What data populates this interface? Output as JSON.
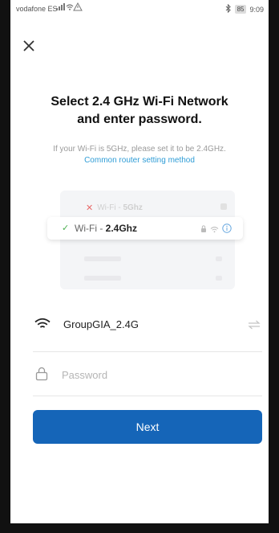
{
  "status_bar": {
    "carrier": "vodafone ES",
    "battery": "85",
    "time": "9:09"
  },
  "header": {
    "close_icon": "close-icon"
  },
  "content": {
    "title_line1": "Select 2.4 GHz Wi-Fi Network",
    "title_line2": "and enter password.",
    "hint": "If your Wi-Fi is 5GHz, please set it to be 2.4GHz.",
    "link": "Common router setting method"
  },
  "illustration": {
    "row_5g": {
      "prefix": "Wi-Fi - ",
      "band": "5Ghz"
    },
    "row_24g": {
      "prefix": "Wi-Fi - ",
      "band": "2.4Ghz"
    }
  },
  "form": {
    "ssid": "GroupGIA_2.4G",
    "password_placeholder": "Password"
  },
  "actions": {
    "next_label": "Next"
  },
  "colors": {
    "primary": "#1565b8",
    "link": "#2e9cd6",
    "check": "#4caf50",
    "cross": "#e86a6a"
  }
}
